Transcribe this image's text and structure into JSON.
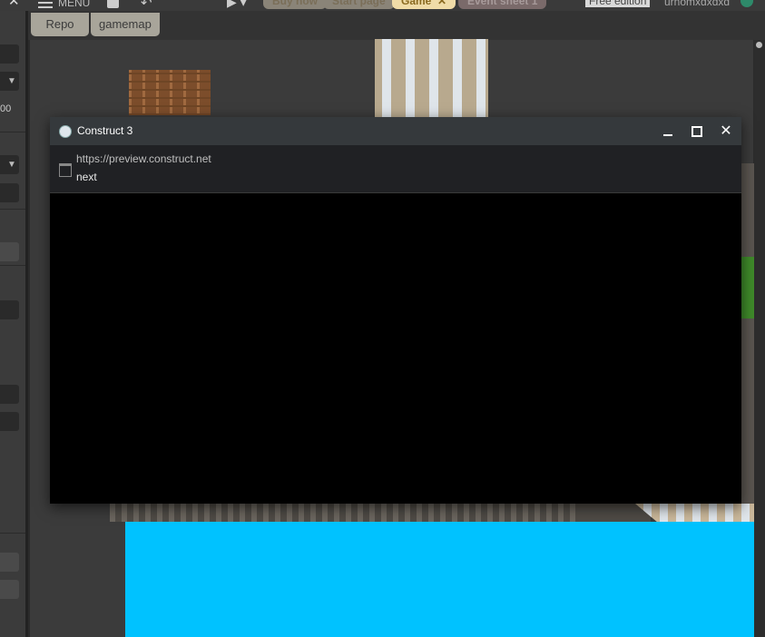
{
  "toolbar": {
    "menu_label": "MENU",
    "tabs": [
      {
        "label": "Buy now"
      },
      {
        "label": "Start page"
      },
      {
        "label": "Game",
        "close": "✕"
      },
      {
        "label": "Event sheet 1"
      }
    ],
    "edition": "Free edition",
    "username": "urnomxdxdxd"
  },
  "left_panel": {
    "value_text": "00"
  },
  "layout_tabs": [
    {
      "label": "Repo"
    },
    {
      "label": "gamemap"
    }
  ],
  "preview_window": {
    "title": "Construct 3",
    "url": "https://preview.construct.net",
    "page_title": "next",
    "close_glyph": "✕"
  },
  "colors": {
    "sky": "#00c2ff",
    "titlebar": "#35393c",
    "active_tab": "#f0dca8"
  }
}
